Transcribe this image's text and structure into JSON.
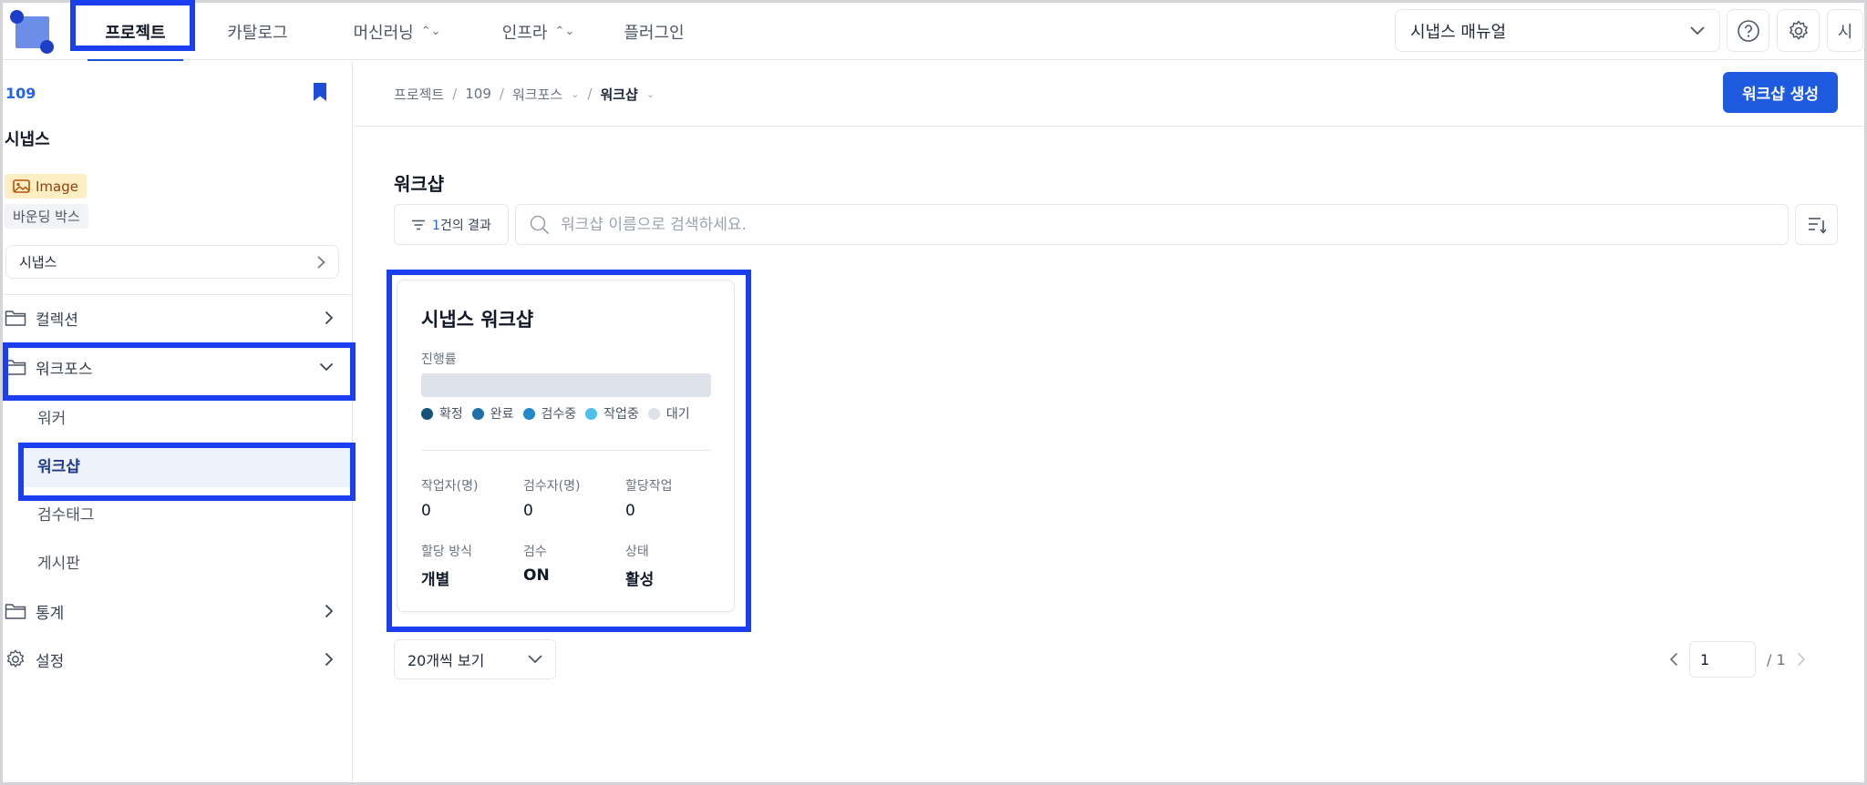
{
  "nav": {
    "tabs": [
      {
        "label": "프로젝트"
      },
      {
        "label": "카탈로그"
      },
      {
        "label": "머신러닝"
      },
      {
        "label": "인프라"
      },
      {
        "label": "플러그인"
      }
    ],
    "manual_select": "시냅스 매뉴얼",
    "help_icon": "question-circle-icon",
    "settings_icon": "gear-icon",
    "user_initial": "시"
  },
  "sidebar": {
    "project_id": "109",
    "project_name": "시냅스",
    "badges": {
      "image": "Image",
      "bbox": "바운딩 박스"
    },
    "select_value": "시냅스",
    "items": [
      {
        "label": "컬렉션"
      },
      {
        "label": "워크포스"
      },
      {
        "label": "통계"
      },
      {
        "label": "설정"
      }
    ],
    "sub_items": [
      {
        "label": "워커"
      },
      {
        "label": "워크샵"
      },
      {
        "label": "검수태그"
      },
      {
        "label": "게시판"
      }
    ]
  },
  "breadcrumb": [
    "프로젝트",
    "109",
    "워크포스",
    "워크샵"
  ],
  "create_button": "워크샵 생성",
  "page_title": "워크샵",
  "result": {
    "count": "1",
    "suffix": "건의 결과"
  },
  "search": {
    "placeholder": "워크샵 이름으로 검색하세요."
  },
  "card": {
    "title": "시냅스 워크샵",
    "progress_label": "진행률",
    "progress": 0,
    "legend": [
      {
        "label": "확정",
        "color": "#15527a"
      },
      {
        "label": "완료",
        "color": "#1f6fa8"
      },
      {
        "label": "검수중",
        "color": "#2389c9"
      },
      {
        "label": "작업중",
        "color": "#4ec0ea"
      },
      {
        "label": "대기",
        "color": "#dde2ea"
      }
    ],
    "stats": {
      "workers_label": "작업자(명)",
      "workers": "0",
      "reviewers_label": "검수자(명)",
      "reviewers": "0",
      "assigned_label": "할당작업",
      "assigned": "0",
      "method_label": "할당 방식",
      "method": "개별",
      "review_label": "검수",
      "review": "ON",
      "status_label": "상태",
      "status": "활성"
    }
  },
  "footer": {
    "per_page": "20개씩 보기",
    "page": "1",
    "total": "/ 1"
  }
}
